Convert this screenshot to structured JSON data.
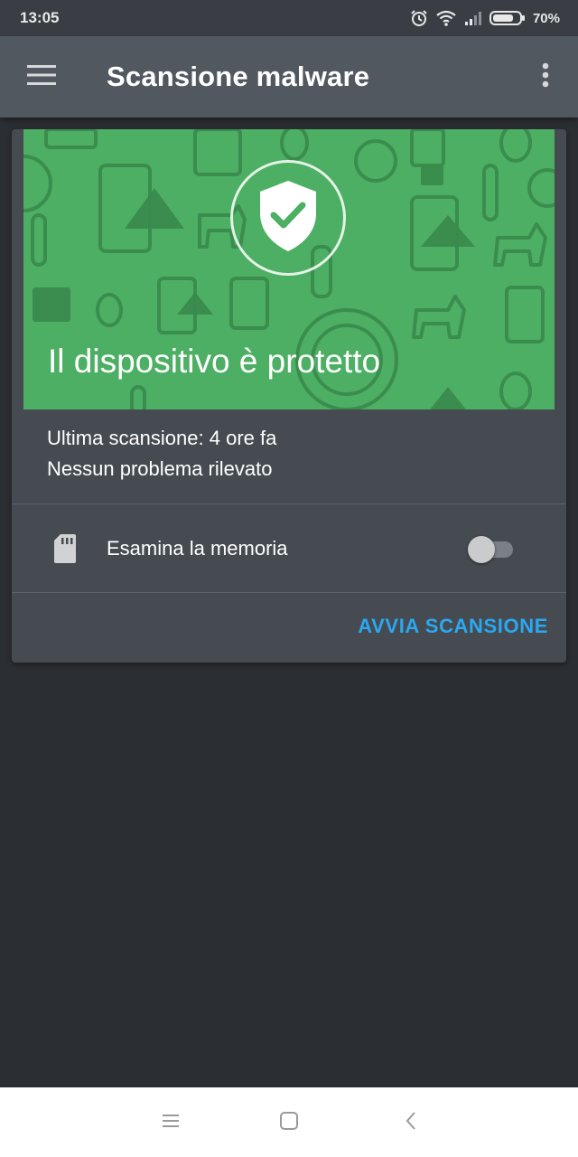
{
  "status_bar": {
    "time": "13:05",
    "battery_percent": "70%",
    "battery_level": 0.7,
    "icons": [
      "alarm-icon",
      "wifi-icon",
      "signal-icon",
      "battery-icon"
    ]
  },
  "app_bar": {
    "title": "Scansione malware",
    "menu_icon": "hamburger-menu-icon",
    "overflow_icon": "more-vert-icon"
  },
  "card": {
    "hero_title": "Il dispositivo è protetto",
    "hero_icon": "shield-check-icon",
    "hero_color": "#4caf63",
    "last_scan": "Ultima scansione: 4 ore fa",
    "status_text": "Nessun problema rilevato",
    "memory_option": {
      "label": "Esamina la memoria",
      "icon": "sd-card-icon",
      "enabled": false
    },
    "action_label": "AVVIA SCANSIONE",
    "action_color": "#2aa8f2"
  },
  "nav_bar": {
    "icons": [
      "recents-menu-icon",
      "home-square-icon",
      "back-chevron-icon"
    ]
  }
}
